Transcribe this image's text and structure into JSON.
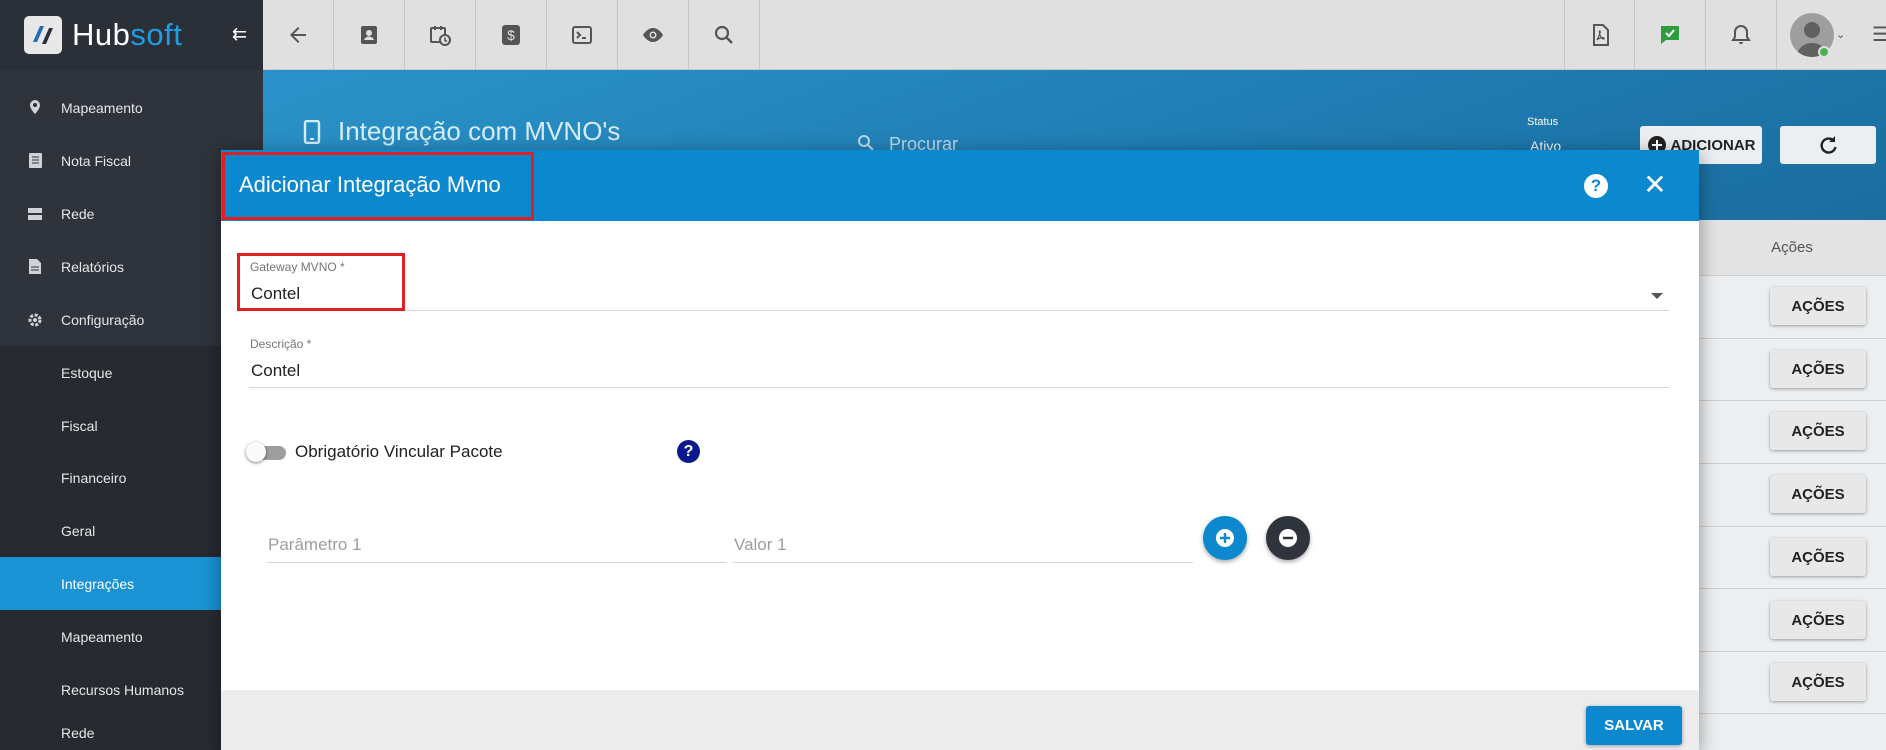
{
  "app": {
    "logo_hub": "Hub",
    "logo_soft": "soft"
  },
  "sidebar": {
    "items": [
      {
        "label": "Mapeamento",
        "icon": "map-pin-icon",
        "type": "top"
      },
      {
        "label": "Nota Fiscal",
        "icon": "invoice-icon",
        "type": "top"
      },
      {
        "label": "Rede",
        "icon": "server-icon",
        "type": "top"
      },
      {
        "label": "Relatórios",
        "icon": "report-icon",
        "type": "top"
      },
      {
        "label": "Configuração",
        "icon": "gear-icon",
        "type": "top"
      },
      {
        "label": "Estoque",
        "type": "sub"
      },
      {
        "label": "Fiscal",
        "type": "sub"
      },
      {
        "label": "Financeiro",
        "type": "sub"
      },
      {
        "label": "Geral",
        "type": "sub"
      },
      {
        "label": "Integrações",
        "type": "sub",
        "active": true
      },
      {
        "label": "Mapeamento",
        "type": "sub"
      },
      {
        "label": "Recursos Humanos",
        "type": "sub"
      },
      {
        "label": "Rede",
        "type": "sub"
      }
    ]
  },
  "header": {
    "page_title": "Integração com MVNO's",
    "search_placeholder": "Procurar",
    "status_label": "Status",
    "status_value": "Ativo",
    "add_label": "ADICIONAR"
  },
  "table": {
    "actions_header": "Ações",
    "row_action_label": "AÇÕES"
  },
  "modal": {
    "title": "Adicionar Integração Mvno",
    "gateway": {
      "label": "Gateway MVNO *",
      "value": "Contel"
    },
    "descricao": {
      "label": "Descrição *",
      "value": "Contel"
    },
    "toggle_label": "Obrigatório Vincular Pacote",
    "toggle_on": false,
    "param_placeholder": "Parâmetro 1",
    "value_placeholder": "Valor 1",
    "save_label": "SALVAR"
  },
  "colors": {
    "accent": "#0c88cf",
    "sidebar": "#2f333c",
    "highlight_frame": "#e02020"
  }
}
